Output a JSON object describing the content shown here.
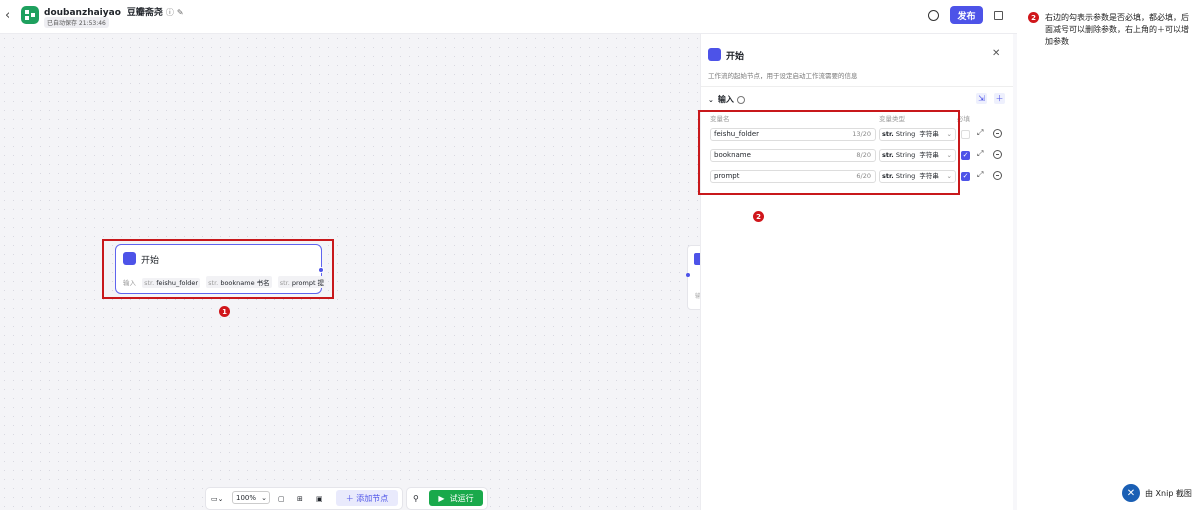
{
  "header": {
    "app_name": "doubanzhaiyao",
    "subtitle": "豆瓣斋尧",
    "info_icon": "ⓘ",
    "edit_icon": "✎",
    "saved": "已自动保存 21:53:46",
    "publish": "发布"
  },
  "node": {
    "title": "开始",
    "input_label": "输入",
    "params": [
      {
        "type": "str.",
        "name": "feishu_folder",
        "desc": ""
      },
      {
        "type": "str.",
        "name": "bookname",
        "desc": "书名"
      },
      {
        "type": "str.",
        "name": "prompt",
        "desc": "提"
      }
    ]
  },
  "ghost_text": "输",
  "badges": {
    "one": "1",
    "two": "2"
  },
  "toolbar": {
    "zoom": "100%",
    "add_node": "添加节点",
    "run": "试运行"
  },
  "panel": {
    "title": "开始",
    "description": "工作流的起始节点，用于设定启动工作流需要的信息",
    "section": "输入",
    "col_name": "变量名",
    "col_type": "变量类型",
    "col_required": "必填",
    "rows": [
      {
        "name": "feishu_folder",
        "count": "13/20",
        "type_prefix": "str.",
        "type": "String",
        "type_cn": "字符串",
        "required": false
      },
      {
        "name": "bookname",
        "count": "8/20",
        "type_prefix": "str.",
        "type": "String",
        "type_cn": "字符串",
        "required": true
      },
      {
        "name": "prompt",
        "count": "6/20",
        "type_prefix": "str.",
        "type": "String",
        "type_cn": "字符串",
        "required": true
      }
    ]
  },
  "annotation": {
    "number": "2",
    "text": "右边的勾表示参数是否必填，都必填，后面减号可以删除参数，右上角的＋可以增加参数"
  },
  "watermark": "由 Xnip 截图",
  "colors": {
    "accent": "#4d53e8",
    "run": "#19a94b",
    "annotation_red": "#c8181b"
  }
}
